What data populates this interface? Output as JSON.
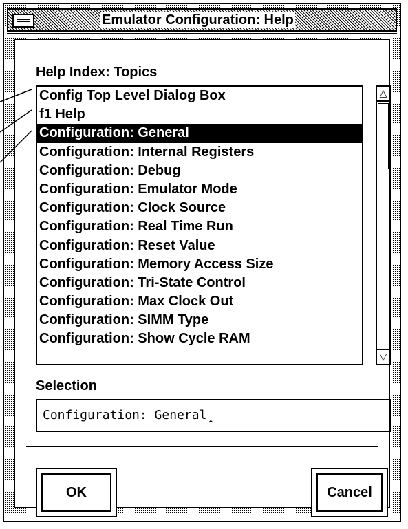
{
  "window": {
    "title": "Emulator Configuration: Help"
  },
  "help_index": {
    "label": "Help Index: Topics",
    "items": [
      "Config Top Level Dialog Box",
      "f1 Help",
      "Configuration: General",
      "Configuration: Internal Registers",
      "Configuration: Debug",
      "Configuration: Emulator Mode",
      "Configuration: Clock Source",
      "Configuration: Real Time Run",
      "Configuration: Reset Value",
      "Configuration: Memory Access Size",
      "Configuration: Tri-State Control",
      "Configuration: Max Clock Out",
      "Configuration: SIMM Type",
      "Configuration: Show Cycle RAM"
    ],
    "selected_item": "Configuration: General"
  },
  "selection": {
    "label": "Selection",
    "value": "Configuration: General"
  },
  "buttons": {
    "ok": "OK",
    "cancel": "Cancel"
  },
  "icons": {
    "system_menu": "system-menu-icon",
    "scroll_up": "triangle-up-icon",
    "scroll_down": "triangle-down-icon",
    "text_cursor": "caret-icon"
  }
}
